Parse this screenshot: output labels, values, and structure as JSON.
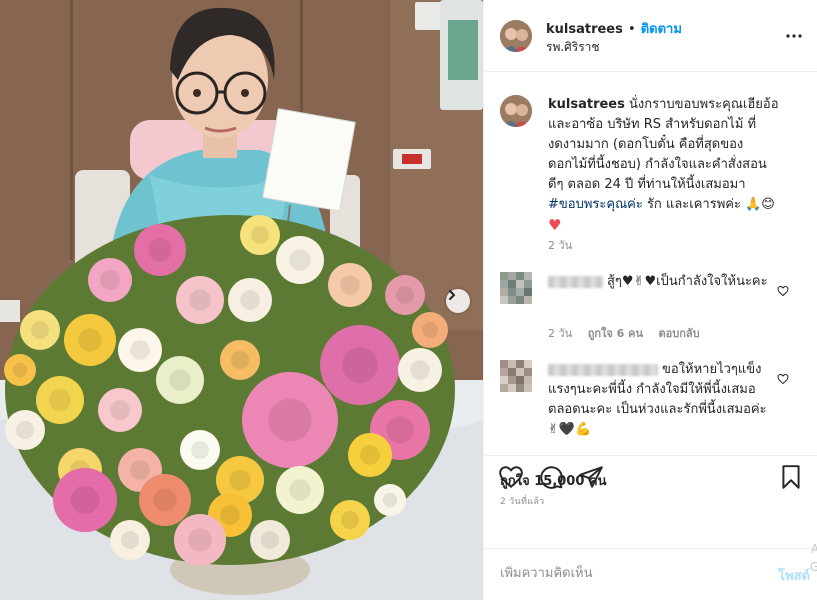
{
  "post": {
    "username": "kulsatrees",
    "follow_dot": "•",
    "follow_label": "ติดตาม",
    "location": "รพ.ศิริราช",
    "caption_username": "kulsatrees",
    "caption_text": "นั่งกราบขอบพระคุณเฮียอ้อและอาซ้อ บริษัท RS สำหรับดอกไม้ ที่งดงามมาก (ดอกโบตั๋น คือที่สุดของดอกไม้ที่นี้งชอบ) กำลังใจและคำสั่งสอนดีๆ ตลอด 24 ปี ที่ท่านให้นี้งเสมอมา",
    "caption_hashtag": "#ขอบพระคุณค่ะ",
    "caption_tail": "รัก และเคารพค่ะ 🙏😊",
    "caption_heart": "♥",
    "caption_age": "2 วัน"
  },
  "comments": [
    {
      "text": "สู้ๆ♥✌♥เป็นกำลังใจให้นะคะ",
      "age": "2 วัน",
      "likes": "ถูกใจ 6 คน",
      "reply": "ตอบกลับ"
    },
    {
      "text": "ขอให้หายไวๆแข็งแรงๆนะคะพี่นี้ง กำลังใจมีให้พี่นี้งเสมอตลอดนะคะ เป็นห่วงและรักพี่นี้งเสมอค่ะ ✌🖤💪"
    }
  ],
  "footer": {
    "likes_label": "ถูกใจ 15,000 คน",
    "post_time": "2 วันที่แล้ว",
    "comment_placeholder": "เพิ่มความคิดเห็น",
    "post_label": "โพสต์"
  },
  "photo": {
    "card_lines": [
      "— — —",
      "— — — —",
      "—— —",
      "— — —"
    ]
  },
  "watermark": {
    "line1": "A",
    "line2": "G"
  },
  "colors": {
    "accent": "#0095f6",
    "hashtag": "#00376b",
    "heart": "#ed4956",
    "muted": "#8e8e8e"
  },
  "icons": {
    "more": "more-horizontal-icon",
    "like": "heart-icon",
    "comment": "comment-icon",
    "share": "paper-plane-icon",
    "save": "bookmark-icon",
    "next": "chevron-right-icon"
  }
}
